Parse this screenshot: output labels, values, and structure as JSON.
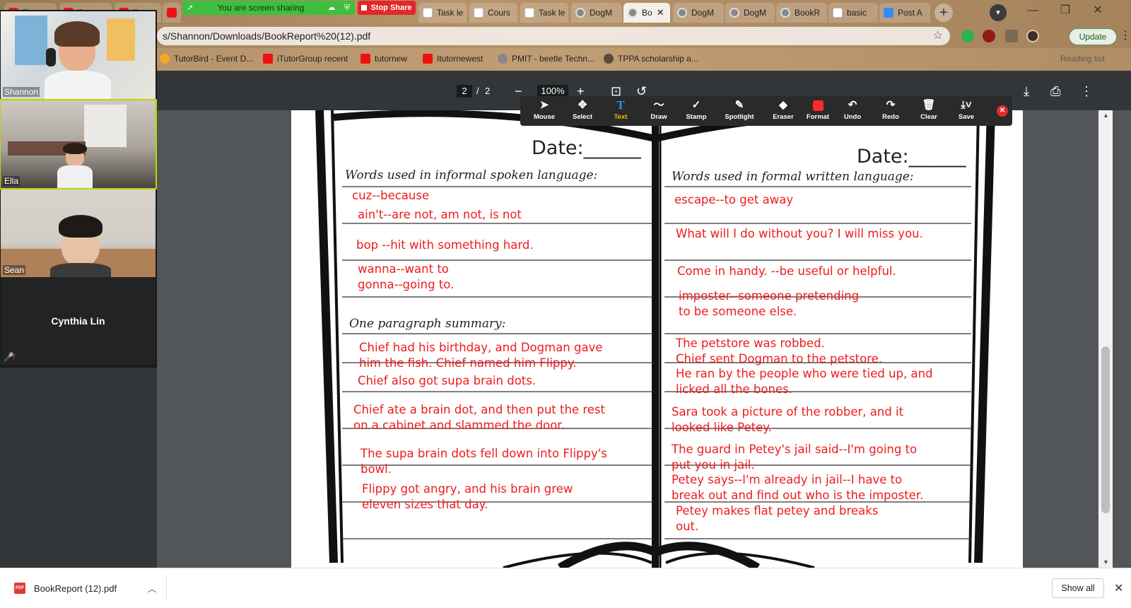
{
  "tabs": [
    {
      "label": "Tu"
    },
    {
      "label": "Tu"
    },
    {
      "label": "Tu"
    },
    {
      "label": ""
    },
    {
      "label": ""
    },
    {
      "label": "Task le"
    },
    {
      "label": "Cours"
    },
    {
      "label": "Task le"
    },
    {
      "label": "DogM"
    },
    {
      "label": "Bo"
    },
    {
      "label": "DogM"
    },
    {
      "label": "DogM"
    },
    {
      "label": "BookR"
    },
    {
      "label": "basic"
    },
    {
      "label": "Post A"
    }
  ],
  "screen_share": {
    "message": "You are screen sharing",
    "stop_label": "Stop Share"
  },
  "address": {
    "url": "s/Shannon/Downloads/BookReport%20(12).pdf"
  },
  "update_label": "Update",
  "bookmarks": [
    {
      "label": "TutorBird - Event D..."
    },
    {
      "label": "iTutorGroup recent"
    },
    {
      "label": "tutornew"
    },
    {
      "label": "Itutornewest"
    },
    {
      "label": "PMIT - beetle Techn..."
    },
    {
      "label": "TPPA scholarship a..."
    }
  ],
  "reading_list": "Reading list",
  "pdf": {
    "current_page": "2",
    "page_sep": "/",
    "total_pages": "2",
    "zoom": "100%",
    "left_page": {
      "date_label": "Date:______",
      "heading1": "Words used in informal spoken language:",
      "heading2": "One paragraph summary:",
      "annotations": [
        "cuz--because",
        "ain't--are not, am not, is not",
        "bop --hit with something hard.",
        "wanna--want to",
        "gonna--going to.",
        "Chief had his birthday, and Dogman gave",
        "him the fish.  Chief named him Flippy.",
        "Chief also got supa brain dots.",
        "Chief ate a brain dot, and then put the rest",
        "on a cabinet and slammed the door.",
        "The supa brain dots fell down into Flippy's",
        "bowl.",
        "Flippy got angry, and his brain grew",
        "eleven sizes that day."
      ]
    },
    "right_page": {
      "date_label": "Date:______",
      "heading1": "Words used in formal written language:",
      "annotations": [
        "escape--to get away",
        "What will I do without you?  I will miss you.",
        "Come in handy. --be useful or helpful.",
        "imposter--someone pretending",
        "to be someone else.",
        "The petstore was robbed.",
        "Chief sent Dogman to the petstore.",
        "He ran by the people who were tied up, and",
        "licked all the bones.",
        "Sara took a picture of the robber, and it",
        "looked like Petey.",
        "The guard in Petey's jail said--I'm going to",
        "put you in jail.",
        "Petey says--I'm already in jail--I have to",
        "break out and find out who is the imposter.",
        "Petey makes flat petey and breaks",
        "out."
      ]
    }
  },
  "annotate_toolbar": {
    "mouse": "Mouse",
    "select": "Select",
    "text": "Text",
    "draw": "Draw",
    "stamp": "Stamp",
    "spotlight": "Spotlight",
    "eraser": "Eraser",
    "format": "Format",
    "undo": "Undo",
    "redo": "Redo",
    "clear": "Clear",
    "save": "Save",
    "active_tool_color": "#2d8cff",
    "format_color": "#ff2a2a"
  },
  "participants": [
    {
      "name": "Shannon"
    },
    {
      "name": "Ella"
    },
    {
      "name": "Sean"
    },
    {
      "name": "Cynthia Lin"
    }
  ],
  "download": {
    "filename": "BookReport (12).pdf",
    "file_icon_label": "PDF",
    "show_all": "Show all"
  },
  "colors": {
    "annotation_red": "#ee1c1c",
    "share_green": "#3fbf3f",
    "stop_red": "#e02828",
    "video_selected": "#b5d800"
  }
}
